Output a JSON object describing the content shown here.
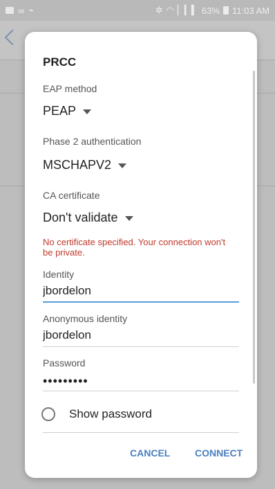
{
  "status_bar": {
    "battery": "63%",
    "time": "11:03 AM",
    "left_icons": [
      "image-icon",
      "voicemail-icon",
      "usb-icon"
    ],
    "right_icons": [
      "bluetooth-icon",
      "wifi-icon",
      "signal-icon",
      "battery-icon"
    ]
  },
  "dialog": {
    "title": "PRCC",
    "eap_method": {
      "label": "EAP method",
      "value": "PEAP"
    },
    "phase2": {
      "label": "Phase 2 authentication",
      "value": "MSCHAPV2"
    },
    "ca_certificate": {
      "label": "CA certificate",
      "value": "Don't validate"
    },
    "error": "No certificate specified. Your connection won't be private.",
    "identity": {
      "label": "Identity",
      "value": "jbordelon"
    },
    "anonymous_identity": {
      "label": "Anonymous identity",
      "value": "jbordelon"
    },
    "password": {
      "label": "Password",
      "value": "•••••••••"
    },
    "show_password": {
      "label": "Show password",
      "checked": false
    },
    "buttons": {
      "cancel": "CANCEL",
      "connect": "CONNECT"
    }
  },
  "colors": {
    "accent": "#4a7fc0",
    "error": "#c0392b",
    "focus_underline": "#5b9bd5"
  }
}
